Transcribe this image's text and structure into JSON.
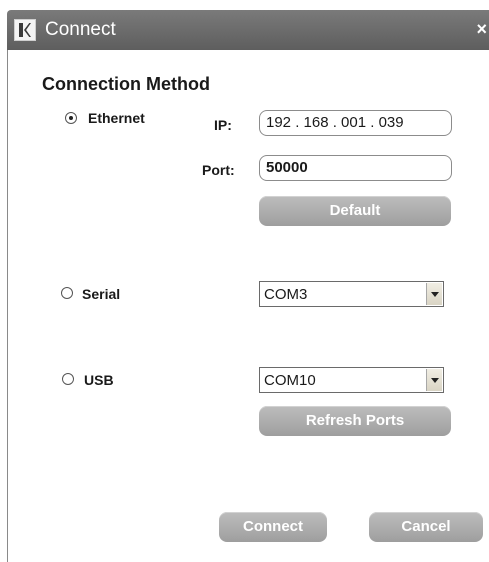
{
  "window": {
    "title": "Connect",
    "close_glyph": "×",
    "logo_icon": "kramer-k-logo"
  },
  "heading": "Connection Method",
  "ethernet": {
    "label": "Ethernet",
    "selected": true,
    "ip_label": "IP:",
    "ip_value": "192 . 168 . 001 . 039",
    "port_label": "Port:",
    "port_value": "50000",
    "default_button": "Default"
  },
  "serial": {
    "label": "Serial",
    "selected": false,
    "port_value": "COM3"
  },
  "usb": {
    "label": "USB",
    "selected": false,
    "port_value": "COM10",
    "refresh_button": "Refresh Ports"
  },
  "footer": {
    "connect_button": "Connect",
    "cancel_button": "Cancel"
  }
}
